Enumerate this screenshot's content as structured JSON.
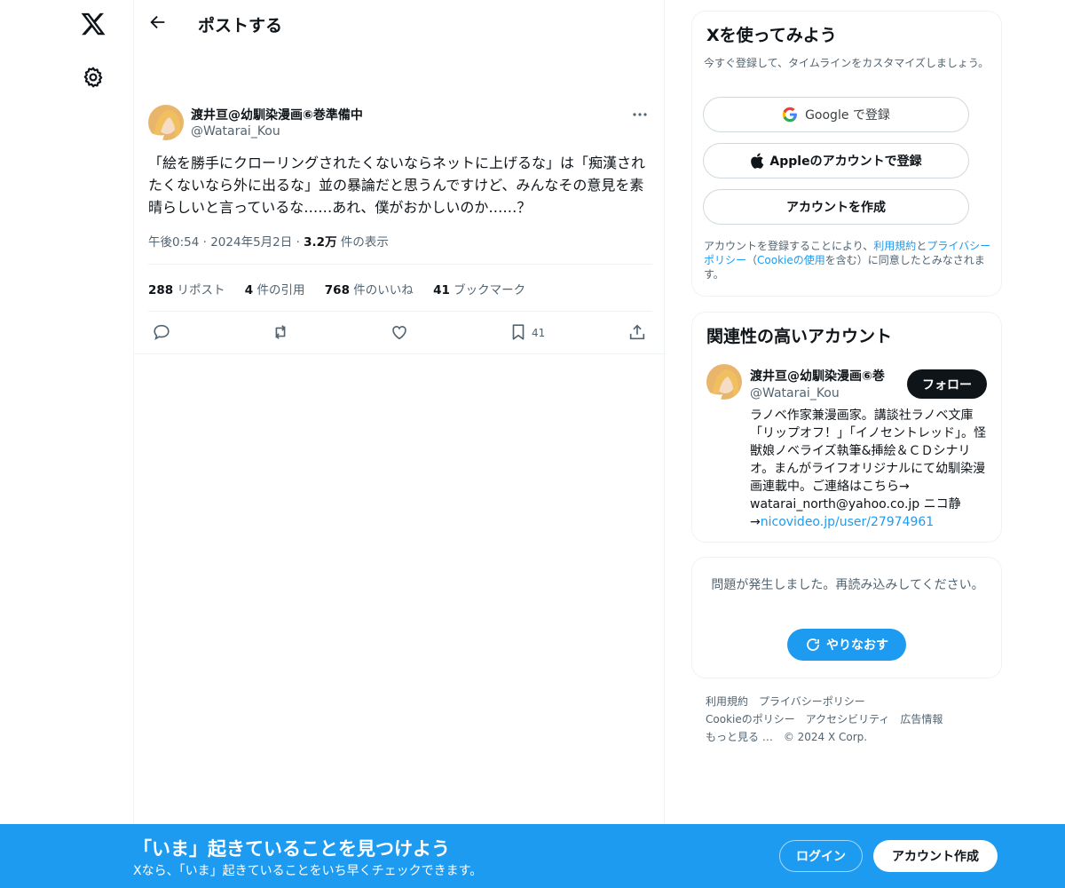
{
  "nav": {
    "logo_icon": "x-logo-icon",
    "settings_icon": "gear-icon"
  },
  "header": {
    "title": "ポストする"
  },
  "post": {
    "author_name": "渡井亘@幼馴染漫画⑥巻準備中",
    "author_handle": "@Watarai_Kou",
    "text": "「絵を勝手にクローリングされたくないならネットに上げるな」は「痴漢されたくないなら外に出るな」並の暴論だと思うんですけど、みんなその意見を素晴らしいと言っているな……あれ、僕がおかしいのか……？",
    "time": "午後0:54",
    "date": "2024年5月2日",
    "views_count": "3.2万",
    "views_label": "件の表示",
    "stats": {
      "reposts_count": "288",
      "reposts_label": "リポスト",
      "quotes_count": "4",
      "quotes_label": "件の引用",
      "likes_count": "768",
      "likes_label": "件のいいね",
      "bookmarks_count": "41",
      "bookmarks_label": "ブックマーク"
    },
    "bookmark_action_count": "41"
  },
  "signup": {
    "title": "Xを使ってみよう",
    "subtitle": "今すぐ登録して、タイムラインをカスタマイズしましょう。",
    "google_label": "Google で登録",
    "apple_label": "Appleのアカウントで登録",
    "create_label": "アカウントを作成",
    "terms_prefix": "アカウントを登録することにより、",
    "terms_link": "利用規約",
    "terms_and": "と",
    "privacy_link": "プライバシーポリシー",
    "terms_paren_open": "（",
    "cookie_link": "Cookieの使用",
    "terms_suffix": "を含む）に同意したとみなされます。"
  },
  "related": {
    "title": "関連性の高いアカウント",
    "name": "渡井亘@幼馴染漫画⑥巻",
    "handle": "@Watarai_Kou",
    "follow_label": "フォロー",
    "bio": "ラノベ作家兼漫画家。講談社ラノベ文庫「リップオフ！」「イノセントレッド」。怪獣娘ノベライズ執筆&挿絵＆ＣＤシナリオ。まんがライフオリジナルにて幼馴染漫画連載中。ご連絡はこちら→ watarai_north@yahoo.co.jp ニコ静→",
    "bio_link": "nicovideo.jp/user/27974961"
  },
  "error": {
    "message": "問題が発生しました。再読み込みしてください。",
    "retry_label": "やりなおす"
  },
  "footer": {
    "terms": "利用規約",
    "privacy": "プライバシーポリシー",
    "cookie": "Cookieのポリシー",
    "accessibility": "アクセシビリティ",
    "ads": "広告情報",
    "more": "もっと見る …",
    "copyright": "© 2024 X Corp."
  },
  "banner": {
    "title": "「いま」起きていることを見つけよう",
    "subtitle": "Xなら、「いま」起きていることをいち早くチェックできます。",
    "login_label": "ログイン",
    "create_label": "アカウント作成"
  },
  "colors": {
    "accent": "#1d9bf0",
    "text": "#0f1419",
    "muted": "#536471",
    "border": "#eff3f4"
  }
}
